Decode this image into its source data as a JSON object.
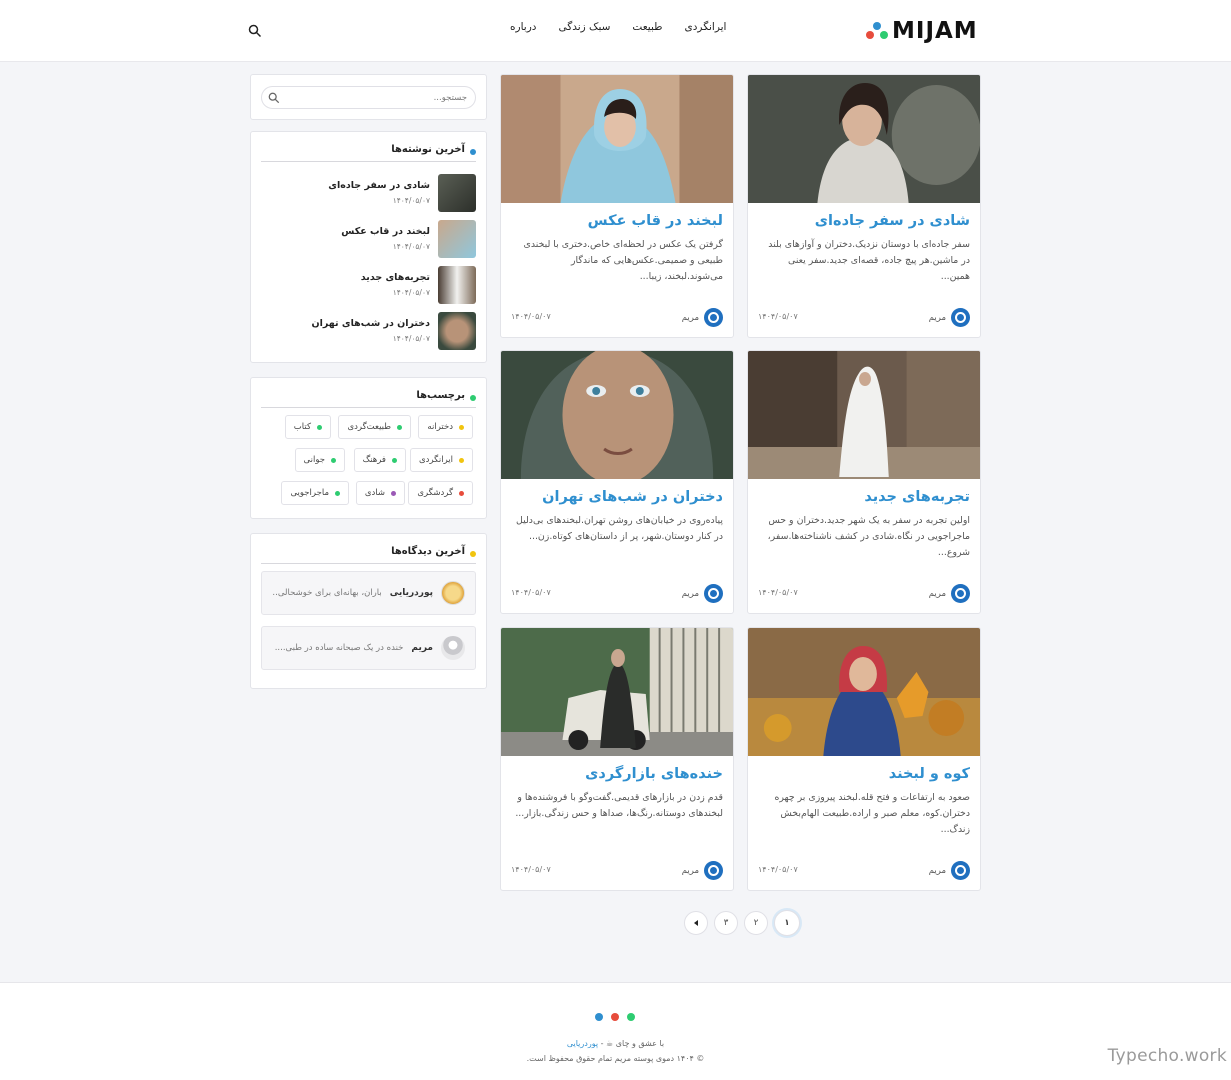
{
  "brand": {
    "name": "MIJAM",
    "dot_colors": [
      "#e74c3c",
      "#2f8fcf",
      "#2ecc71"
    ]
  },
  "nav": [
    "ایرانگردی",
    "طبیعت",
    "سبک زندگی",
    "درباره"
  ],
  "sidebar_search": {
    "placeholder": "جستجو..."
  },
  "recent_posts": {
    "title": "آخرین نوشته‌ها",
    "items": [
      {
        "title": "شادی در سفر جاده‌ای",
        "date": "۱۴۰۴/۰۵/۰۷"
      },
      {
        "title": "لبخند در قاب عکس",
        "date": "۱۴۰۴/۰۵/۰۷"
      },
      {
        "title": "تجربه‌های جدید",
        "date": "۱۴۰۴/۰۵/۰۷"
      },
      {
        "title": "دختران در شب‌های تهران",
        "date": "۱۴۰۴/۰۵/۰۷"
      }
    ]
  },
  "tags": {
    "title": "برچسب‌ها",
    "items": [
      {
        "label": "دخترانه",
        "color": "#f1c40f"
      },
      {
        "label": "طبیعت‌گردی",
        "color": "#2ecc71"
      },
      {
        "label": "کتاب",
        "color": "#2ecc71"
      },
      {
        "label": "ایرانگردی",
        "color": "#f1c40f"
      },
      {
        "label": "فرهنگ",
        "color": "#2ecc71"
      },
      {
        "label": "جوانی",
        "color": "#2ecc71"
      },
      {
        "label": "گردشگری",
        "color": "#e74c3c"
      },
      {
        "label": "شادی",
        "color": "#9b59b6"
      },
      {
        "label": "ماجراجویی",
        "color": "#2ecc71"
      }
    ]
  },
  "recent_comments": {
    "title": "آخرین دیدگاه‌ها",
    "items": [
      {
        "author": "پوردریایی",
        "text": "باران، بهانه‌ای برای خوشحالی...."
      },
      {
        "author": "مریم",
        "text": "خنده در یک صبحانه ساده در طبی...."
      }
    ]
  },
  "posts": [
    {
      "title": "شادی در سفر جاده‌ای",
      "excerpt": "سفر جاده‌ای با دوستان نزدیک.دختران و آوازهای بلند در ماشین.هر پیچ جاده، قصه‌ای جدید.سفر یعنی همین...",
      "author": "مریم",
      "date": "۱۴۰۴/۰۵/۰۷"
    },
    {
      "title": "لبخند در قاب عکس",
      "excerpt": "گرفتن یک عکس در لحظه‌ای خاص.دختری با لبخندی طبیعی و صمیمی.عکس‌هایی که ماندگار می‌شوند.لبخند، زیبا...",
      "author": "مریم",
      "date": "۱۴۰۴/۰۵/۰۷"
    },
    {
      "title": "تجربه‌های جدید",
      "excerpt": "اولین تجربه در سفر به یک شهر جدید.دختران و حس ماجراجویی در نگاه.شادی در کشف ناشناخته‌ها.سفر، شروع...",
      "author": "مریم",
      "date": "۱۴۰۴/۰۵/۰۷"
    },
    {
      "title": "دختران در شب‌های تهران",
      "excerpt": "پیاده‌روی در خیابان‌های روشن تهران.لبخندهای بی‌دلیل در کنار دوستان.شهر، پر از داستان‌های کوتاه.زن...",
      "author": "مریم",
      "date": "۱۴۰۴/۰۵/۰۷"
    },
    {
      "title": "کوه و لبخند",
      "excerpt": "صعود به ارتفاعات و فتح قله.لبخند پیروزی بر چهره دختران.کوه، معلم صبر و اراده.طبیعت الهام‌بخش زندگ...",
      "author": "مریم",
      "date": "۱۴۰۴/۰۵/۰۷"
    },
    {
      "title": "خنده‌های بازارگردی",
      "excerpt": "قدم زدن در بازارهای قدیمی.گفت‌وگو با فروشنده‌ها و لبخندهای دوستانه.رنگ‌ها، صداها و حس زندگی.بازار...",
      "author": "مریم",
      "date": "۱۴۰۴/۰۵/۰۷"
    }
  ],
  "pagination": [
    "۱",
    "۲",
    "۳"
  ],
  "footer": {
    "line1_prefix": "با عشق و چای ☕ - ",
    "line1_link": "پوردریایی",
    "line2": "© ۱۴۰۴ دموی پوسته مریم تمام حقوق محفوظ است."
  },
  "watermark": "Typecho.work"
}
